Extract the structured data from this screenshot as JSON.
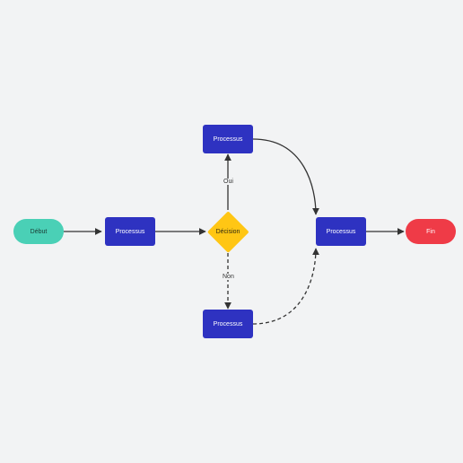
{
  "nodes": {
    "start": {
      "label": "Début"
    },
    "process1": {
      "label": "Processus"
    },
    "decision": {
      "label": "Décision"
    },
    "processTop": {
      "label": "Processus"
    },
    "processBottom": {
      "label": "Processus"
    },
    "process4": {
      "label": "Processus"
    },
    "end": {
      "label": "Fin"
    }
  },
  "edges": {
    "yes": {
      "label": "Oui"
    },
    "no": {
      "label": "Non"
    }
  }
}
